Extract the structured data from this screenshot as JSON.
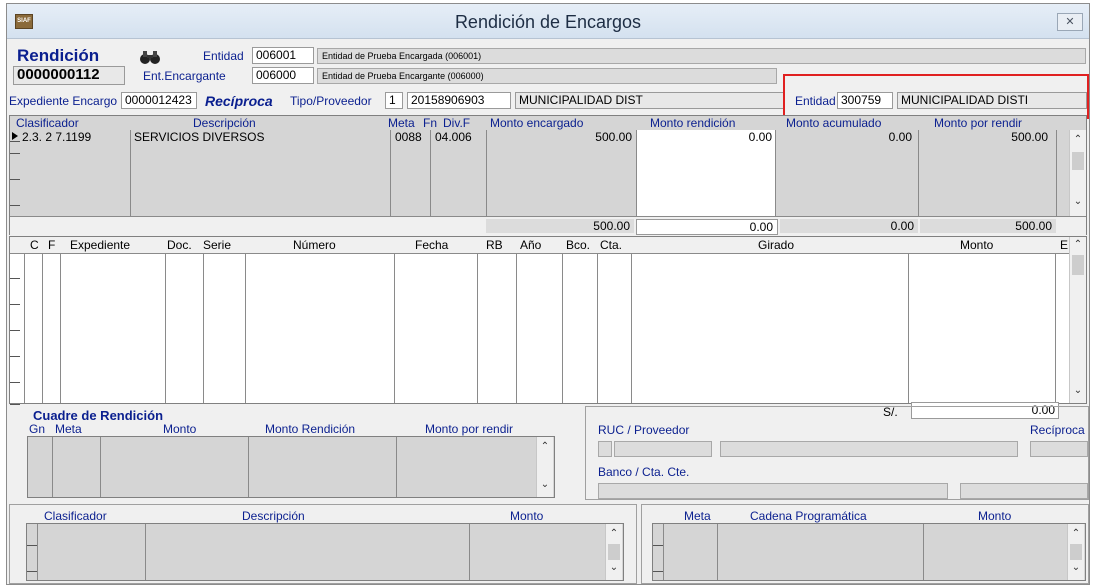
{
  "window": {
    "title": "Rendición de Encargos",
    "app_icon": "SIAF",
    "close_label": "✕"
  },
  "header": {
    "rendicion_label": "Rendición",
    "rendicion_number": "0000000112",
    "entidad_label": "Entidad",
    "entidad_code": "006001",
    "entidad_name": "Entidad de Prueba Encargada (006001)",
    "ent_encargante_label": "Ent.Encargante",
    "ent_encargante_code": "006000",
    "ent_encargante_name": "Entidad de Prueba Encargante (006000)",
    "expediente_label": "Expediente Encargo",
    "expediente_value": "0000012423",
    "reciproca_label": "Recíproca",
    "tipo_proveedor_label": "Tipo/Proveedor",
    "tipo_value": "1",
    "proveedor_ruc": "20158906903",
    "proveedor_name": "MUNICIPALIDAD DIST",
    "entidad2_label": "Entidad",
    "entidad2_code": "300759",
    "entidad2_name": "MUNICIPALIDAD DISTI"
  },
  "grid1": {
    "headers": [
      "Clasificador",
      "Descripción",
      "Meta",
      "Fn",
      "Div.F",
      "Monto encargado",
      "Monto rendición",
      "Monto acumulado",
      "Monto por rendir"
    ],
    "rows": [
      {
        "clasificador": "2.3. 2 7.1199",
        "descripcion": "SERVICIOS DIVERSOS",
        "meta": "0088",
        "fn_div": "04.006",
        "monto_encargado": "500.00",
        "monto_rendicion": "0.00",
        "monto_acumulado": "0.00",
        "monto_por_rendir": "500.00"
      }
    ],
    "totals": {
      "monto_encargado": "500.00",
      "monto_rendicion": "0.00",
      "monto_acumulado": "0.00",
      "monto_por_rendir": "500.00"
    }
  },
  "grid2": {
    "headers": [
      "C",
      "F",
      "Expediente",
      "Doc.",
      "Serie",
      "Número",
      "Fecha",
      "RB",
      "Año",
      "Bco.",
      "Cta.",
      "Girado",
      "Monto",
      "E"
    ],
    "currency_label": "S/.",
    "total": "0.00"
  },
  "cuadre": {
    "title": "Cuadre de Rendición",
    "headers": [
      "Gn",
      "Meta",
      "Monto",
      "Monto Rendición",
      "Monto por rendir"
    ]
  },
  "right_panel": {
    "ruc_label": "RUC / Proveedor",
    "reciproca_label": "Recíproca",
    "banco_label": "Banco / Cta. Cte."
  },
  "bottom_left": {
    "headers": [
      "Clasificador",
      "Descripción",
      "Monto"
    ]
  },
  "bottom_right": {
    "headers": [
      "Meta",
      "Cadena Programática",
      "Monto"
    ]
  },
  "colors": {
    "highlight_box": "#e02020",
    "label_blue": "#0a1f8f"
  }
}
